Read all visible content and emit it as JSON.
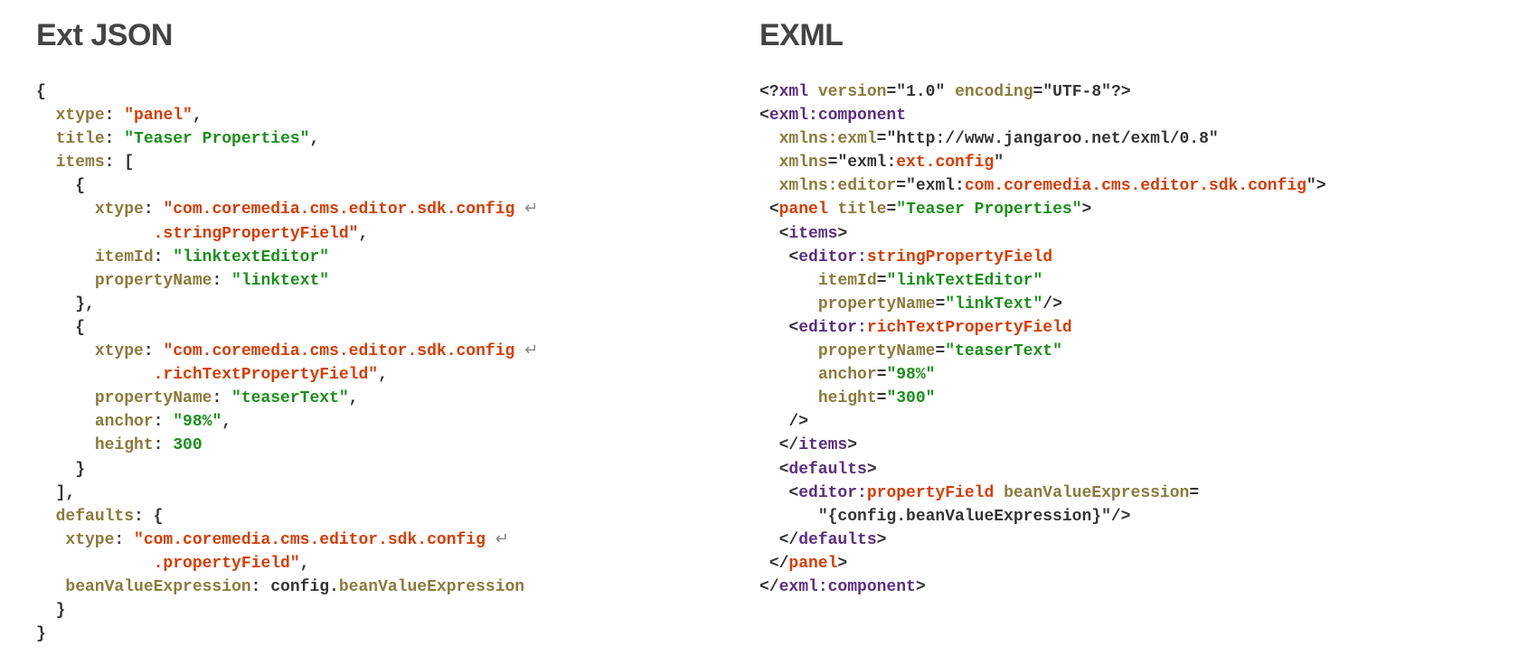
{
  "left": {
    "heading": "Ext JSON",
    "lines": [
      [
        {
          "c": "p",
          "t": "{"
        }
      ],
      [
        {
          "c": "p",
          "t": "  "
        },
        {
          "c": "k",
          "t": "xtype"
        },
        {
          "c": "p",
          "t": ": "
        },
        {
          "c": "s",
          "t": "\"panel\""
        },
        {
          "c": "p",
          "t": ","
        }
      ],
      [
        {
          "c": "p",
          "t": "  "
        },
        {
          "c": "k",
          "t": "title"
        },
        {
          "c": "p",
          "t": ": "
        },
        {
          "c": "g",
          "t": "\"Teaser Properties\""
        },
        {
          "c": "p",
          "t": ","
        }
      ],
      [
        {
          "c": "p",
          "t": "  "
        },
        {
          "c": "k",
          "t": "items"
        },
        {
          "c": "p",
          "t": ": ["
        }
      ],
      [
        {
          "c": "p",
          "t": "    {"
        }
      ],
      [
        {
          "c": "p",
          "t": "      "
        },
        {
          "c": "k",
          "t": "xtype"
        },
        {
          "c": "p",
          "t": ": "
        },
        {
          "c": "s",
          "t": "\"com.coremedia.cms.editor.sdk.config "
        },
        {
          "c": "wrap",
          "t": "↵"
        }
      ],
      [
        {
          "c": "p",
          "t": "            "
        },
        {
          "c": "s",
          "t": ".stringPropertyField\""
        },
        {
          "c": "p",
          "t": ","
        }
      ],
      [
        {
          "c": "p",
          "t": "      "
        },
        {
          "c": "k",
          "t": "itemId"
        },
        {
          "c": "p",
          "t": ": "
        },
        {
          "c": "g",
          "t": "\"linktextEditor\""
        }
      ],
      [
        {
          "c": "p",
          "t": "      "
        },
        {
          "c": "k",
          "t": "propertyName"
        },
        {
          "c": "p",
          "t": ": "
        },
        {
          "c": "g",
          "t": "\"linktext\""
        }
      ],
      [
        {
          "c": "p",
          "t": "    },"
        }
      ],
      [
        {
          "c": "p",
          "t": "    {"
        }
      ],
      [
        {
          "c": "p",
          "t": "      "
        },
        {
          "c": "k",
          "t": "xtype"
        },
        {
          "c": "p",
          "t": ": "
        },
        {
          "c": "s",
          "t": "\"com.coremedia.cms.editor.sdk.config "
        },
        {
          "c": "wrap",
          "t": "↵"
        }
      ],
      [
        {
          "c": "p",
          "t": "            "
        },
        {
          "c": "s",
          "t": ".richTextPropertyField\""
        },
        {
          "c": "p",
          "t": ","
        }
      ],
      [
        {
          "c": "p",
          "t": "      "
        },
        {
          "c": "k",
          "t": "propertyName"
        },
        {
          "c": "p",
          "t": ": "
        },
        {
          "c": "g",
          "t": "\"teaserText\""
        },
        {
          "c": "p",
          "t": ","
        }
      ],
      [
        {
          "c": "p",
          "t": "      "
        },
        {
          "c": "k",
          "t": "anchor"
        },
        {
          "c": "p",
          "t": ": "
        },
        {
          "c": "g",
          "t": "\"98%\""
        },
        {
          "c": "p",
          "t": ","
        }
      ],
      [
        {
          "c": "p",
          "t": "      "
        },
        {
          "c": "k",
          "t": "height"
        },
        {
          "c": "p",
          "t": ": "
        },
        {
          "c": "n",
          "t": "300"
        }
      ],
      [
        {
          "c": "p",
          "t": "    }"
        }
      ],
      [
        {
          "c": "p",
          "t": "  ],"
        }
      ],
      [
        {
          "c": "p",
          "t": "  "
        },
        {
          "c": "k",
          "t": "defaults"
        },
        {
          "c": "p",
          "t": ": {"
        }
      ],
      [
        {
          "c": "p",
          "t": "   "
        },
        {
          "c": "k",
          "t": "xtype"
        },
        {
          "c": "p",
          "t": ": "
        },
        {
          "c": "s",
          "t": "\"com.coremedia.cms.editor.sdk.config "
        },
        {
          "c": "wrap",
          "t": "↵"
        }
      ],
      [
        {
          "c": "p",
          "t": "            "
        },
        {
          "c": "s",
          "t": ".propertyField\""
        },
        {
          "c": "p",
          "t": ","
        }
      ],
      [
        {
          "c": "p",
          "t": "   "
        },
        {
          "c": "k",
          "t": "beanValueExpression"
        },
        {
          "c": "p",
          "t": ": "
        },
        {
          "c": "id",
          "t": "config."
        },
        {
          "c": "k",
          "t": "beanValueExpression"
        }
      ],
      [
        {
          "c": "p",
          "t": "  }"
        }
      ],
      [
        {
          "c": "p",
          "t": "}"
        }
      ]
    ]
  },
  "right": {
    "heading": "EXML",
    "lines": [
      [
        {
          "c": "p",
          "t": "<?"
        },
        {
          "c": "tg",
          "t": "xml"
        },
        {
          "c": "p",
          "t": " "
        },
        {
          "c": "k",
          "t": "version"
        },
        {
          "c": "p",
          "t": "="
        },
        {
          "c": "at",
          "t": "\"1.0\""
        },
        {
          "c": "p",
          "t": " "
        },
        {
          "c": "k",
          "t": "encoding"
        },
        {
          "c": "p",
          "t": "="
        },
        {
          "c": "at",
          "t": "\"UTF-8\""
        },
        {
          "c": "p",
          "t": "?>"
        }
      ],
      [
        {
          "c": "p",
          "t": "<"
        },
        {
          "c": "tg",
          "t": "exml:component"
        }
      ],
      [
        {
          "c": "p",
          "t": "  "
        },
        {
          "c": "k",
          "t": "xmlns:exml"
        },
        {
          "c": "p",
          "t": "="
        },
        {
          "c": "at",
          "t": "\"http://www.jangaroo.net/exml/0.8\""
        }
      ],
      [
        {
          "c": "p",
          "t": "  "
        },
        {
          "c": "k",
          "t": "xmlns"
        },
        {
          "c": "p",
          "t": "="
        },
        {
          "c": "at",
          "t": "\"exml:"
        },
        {
          "c": "s",
          "t": "ext.config"
        },
        {
          "c": "at",
          "t": "\""
        }
      ],
      [
        {
          "c": "p",
          "t": "  "
        },
        {
          "c": "k",
          "t": "xmlns:editor"
        },
        {
          "c": "p",
          "t": "="
        },
        {
          "c": "at",
          "t": "\"exml:"
        },
        {
          "c": "s",
          "t": "com.coremedia.cms.editor.sdk.config"
        },
        {
          "c": "at",
          "t": "\""
        },
        {
          "c": "p",
          "t": ">"
        }
      ],
      [
        {
          "c": "p",
          "t": " <"
        },
        {
          "c": "s",
          "t": "panel"
        },
        {
          "c": "p",
          "t": " "
        },
        {
          "c": "k",
          "t": "title"
        },
        {
          "c": "p",
          "t": "="
        },
        {
          "c": "g",
          "t": "\"Teaser Properties\""
        },
        {
          "c": "p",
          "t": ">"
        }
      ],
      [
        {
          "c": "p",
          "t": "  <"
        },
        {
          "c": "tg",
          "t": "items"
        },
        {
          "c": "p",
          "t": ">"
        }
      ],
      [
        {
          "c": "p",
          "t": "   <"
        },
        {
          "c": "tg",
          "t": "editor:"
        },
        {
          "c": "s",
          "t": "stringPropertyField"
        }
      ],
      [
        {
          "c": "p",
          "t": "      "
        },
        {
          "c": "k",
          "t": "itemId"
        },
        {
          "c": "p",
          "t": "="
        },
        {
          "c": "g",
          "t": "\"linkTextEditor\""
        }
      ],
      [
        {
          "c": "p",
          "t": "      "
        },
        {
          "c": "k",
          "t": "propertyName"
        },
        {
          "c": "p",
          "t": "="
        },
        {
          "c": "g",
          "t": "\"linkText\""
        },
        {
          "c": "p",
          "t": "/>"
        }
      ],
      [
        {
          "c": "p",
          "t": "   <"
        },
        {
          "c": "tg",
          "t": "editor:"
        },
        {
          "c": "s",
          "t": "richTextPropertyField"
        }
      ],
      [
        {
          "c": "p",
          "t": "      "
        },
        {
          "c": "k",
          "t": "propertyName"
        },
        {
          "c": "p",
          "t": "="
        },
        {
          "c": "g",
          "t": "\"teaserText\""
        }
      ],
      [
        {
          "c": "p",
          "t": "      "
        },
        {
          "c": "k",
          "t": "anchor"
        },
        {
          "c": "p",
          "t": "="
        },
        {
          "c": "g",
          "t": "\"98%\""
        }
      ],
      [
        {
          "c": "p",
          "t": "      "
        },
        {
          "c": "k",
          "t": "height"
        },
        {
          "c": "p",
          "t": "="
        },
        {
          "c": "g",
          "t": "\"300\""
        }
      ],
      [
        {
          "c": "p",
          "t": "   />"
        }
      ],
      [
        {
          "c": "p",
          "t": "  </"
        },
        {
          "c": "tg",
          "t": "items"
        },
        {
          "c": "p",
          "t": ">"
        }
      ],
      [
        {
          "c": "p",
          "t": "  <"
        },
        {
          "c": "tg",
          "t": "defaults"
        },
        {
          "c": "p",
          "t": ">"
        }
      ],
      [
        {
          "c": "p",
          "t": "   <"
        },
        {
          "c": "tg",
          "t": "editor:"
        },
        {
          "c": "s",
          "t": "propertyField"
        },
        {
          "c": "p",
          "t": " "
        },
        {
          "c": "k",
          "t": "beanValueExpression"
        },
        {
          "c": "p",
          "t": "="
        }
      ],
      [
        {
          "c": "p",
          "t": "      "
        },
        {
          "c": "at",
          "t": "\"{config.beanValueExpression}\""
        },
        {
          "c": "p",
          "t": "/>"
        }
      ],
      [
        {
          "c": "p",
          "t": "  </"
        },
        {
          "c": "tg",
          "t": "defaults"
        },
        {
          "c": "p",
          "t": ">"
        }
      ],
      [
        {
          "c": "p",
          "t": " </"
        },
        {
          "c": "s",
          "t": "panel"
        },
        {
          "c": "p",
          "t": ">"
        }
      ],
      [
        {
          "c": "p",
          "t": "</"
        },
        {
          "c": "tg",
          "t": "exml:component"
        },
        {
          "c": "p",
          "t": ">"
        }
      ]
    ]
  }
}
